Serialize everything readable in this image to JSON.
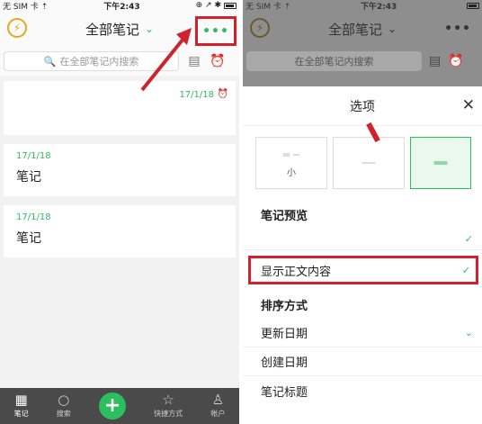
{
  "left": {
    "status": {
      "carrier": "无 SIM 卡 ⇡",
      "time": "下午2:43",
      "right": "⊕ ↗ ✱"
    },
    "nav": {
      "title": "全部笔记",
      "chevron": "⌄",
      "more": "•••",
      "colors": {
        "accent": "#2dbe60",
        "highlight": "#d0222c"
      }
    },
    "search": {
      "placeholder": "在全部笔记内搜索"
    },
    "notes": [
      {
        "title": "",
        "date": "17/1/18"
      },
      {
        "date": "17/1/18",
        "title": "笔记"
      },
      {
        "date": "17/1/18",
        "title": "笔记"
      }
    ],
    "tabs": [
      {
        "label": "笔记",
        "icon": "note-icon"
      },
      {
        "label": "搜索",
        "icon": "search-icon"
      },
      {
        "label": "",
        "icon": "plus-icon"
      },
      {
        "label": "快捷方式",
        "icon": "star-icon"
      },
      {
        "label": "帐户",
        "icon": "account-icon"
      }
    ]
  },
  "right": {
    "status": {
      "carrier": "无 SIM 卡 ⇡",
      "time": "下午2:43"
    },
    "nav": {
      "title": "全部笔记",
      "chevron": "⌄",
      "more": "•••"
    },
    "search": {
      "placeholder": "在全部笔记内搜索"
    },
    "sheet": {
      "title": "选项",
      "close": "✕",
      "layouts": [
        {
          "label": "小",
          "selected": false
        },
        {
          "label": "",
          "selected": false
        },
        {
          "label": "",
          "selected": true
        }
      ],
      "preview_header": "笔记预览",
      "show_body_label": "显示正文内容",
      "sort_header": "排序方式",
      "sort_options": [
        {
          "label": "更新日期",
          "selected": true
        },
        {
          "label": "创建日期",
          "selected": false
        },
        {
          "label": "笔记标题",
          "selected": false
        }
      ],
      "check": "✓"
    }
  }
}
